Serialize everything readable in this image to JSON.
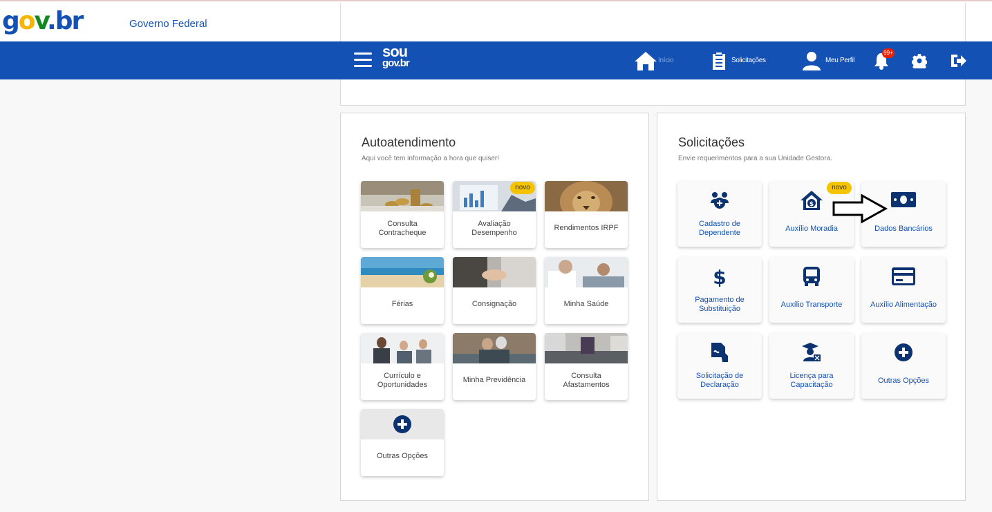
{
  "header": {
    "logo": {
      "g": "g",
      "o": "o",
      "v": "v",
      "br": ".br"
    },
    "title": "Governo Federal"
  },
  "navbar": {
    "logo_top": "sou",
    "logo_bottom": "gov.br",
    "items": [
      {
        "icon": "home-icon",
        "label": "Início"
      },
      {
        "icon": "clipboard-icon",
        "label": "Solicitações"
      },
      {
        "icon": "user-icon",
        "label": "Meu Perfil"
      }
    ],
    "notifications_badge": "99+",
    "brand_color": "#1351b4"
  },
  "autoatendimento": {
    "title": "Autoatendimento",
    "subtitle": "Aqui você tem informação a hora que quiser!",
    "tiles": [
      {
        "label": "Consulta Contracheque"
      },
      {
        "label": "Avaliação Desempenho",
        "badge": "novo"
      },
      {
        "label": "Rendimentos  IRPF"
      },
      {
        "label": "Férias"
      },
      {
        "label": "Consignação"
      },
      {
        "label": "Minha Saúde"
      },
      {
        "label": "Currículo e Oportunidades"
      },
      {
        "label": "Minha  Previdência"
      },
      {
        "label": "Consulta Afastamentos"
      },
      {
        "label": "Outras Opções",
        "icon": "plus-circle-icon"
      }
    ]
  },
  "solicitacoes": {
    "title": "Solicitações",
    "subtitle": "Envie requerimentos para a sua Unidade Gestora.",
    "tiles": [
      {
        "label": "Cadastro de Dependente",
        "icon": "dependents-icon"
      },
      {
        "label": "Auxílio Moradia",
        "icon": "house-money-icon",
        "badge": "novo"
      },
      {
        "label": "Dados Bancários",
        "icon": "banknote-icon"
      },
      {
        "label": "Pagamento de Substituição",
        "icon": "dollar-icon"
      },
      {
        "label": "Auxílio Transporte",
        "icon": "bus-icon"
      },
      {
        "label": "Auxílio Alimentação",
        "icon": "credit-card-icon"
      },
      {
        "label": "Solicitação de Declaração",
        "icon": "signed-document-icon"
      },
      {
        "label": "Licença para Capacitação",
        "icon": "graduation-icon"
      },
      {
        "label": "Outras Opções",
        "icon": "plus-circle-icon"
      }
    ]
  }
}
